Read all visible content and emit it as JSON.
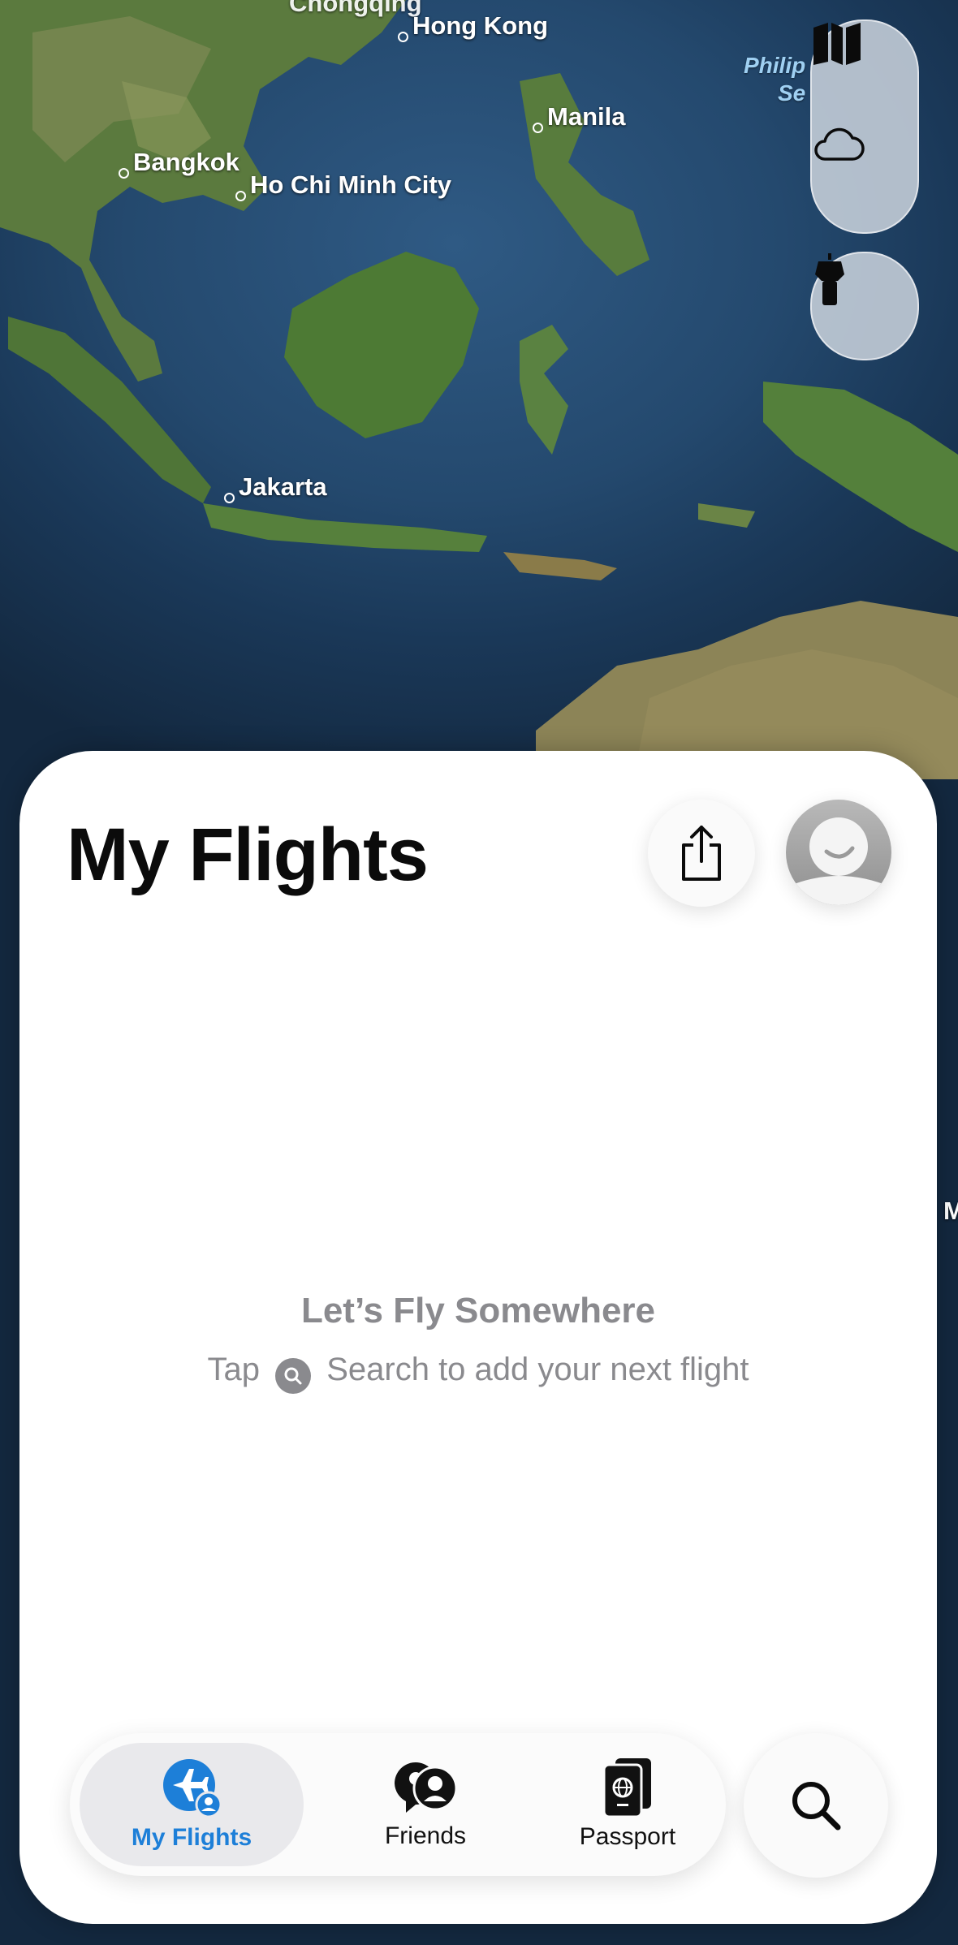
{
  "map": {
    "cities": [
      {
        "name": "Hong Kong"
      },
      {
        "name": "Manila"
      },
      {
        "name": "Bangkok"
      },
      {
        "name": "Ho Chi Minh City"
      },
      {
        "name": "Jakarta"
      }
    ],
    "sea_label": "Philip\nSe",
    "edge_letter": "M",
    "top_partial_city": "Chongqing"
  },
  "controls": {
    "map_icon": "map-icon",
    "weather_icon": "cloud-icon",
    "tower_icon": "control-tower-icon"
  },
  "sheet": {
    "title": "My Flights",
    "share_icon": "share-icon",
    "avatar_icon": "avatar-icon",
    "empty_title": "Let’s Fly Somewhere",
    "empty_sub_before": "Tap",
    "empty_sub_after": "Search to add your next flight"
  },
  "tabs": [
    {
      "label": "My Flights",
      "icon": "my-flights-icon",
      "active": true
    },
    {
      "label": "Friends",
      "icon": "friends-icon",
      "active": false
    },
    {
      "label": "Passport",
      "icon": "passport-icon",
      "active": false
    }
  ],
  "search_button_icon": "search-icon",
  "colors": {
    "accent": "#1d7fd8",
    "sheet": "#ffffff",
    "muted_text": "#8a8a8e"
  }
}
